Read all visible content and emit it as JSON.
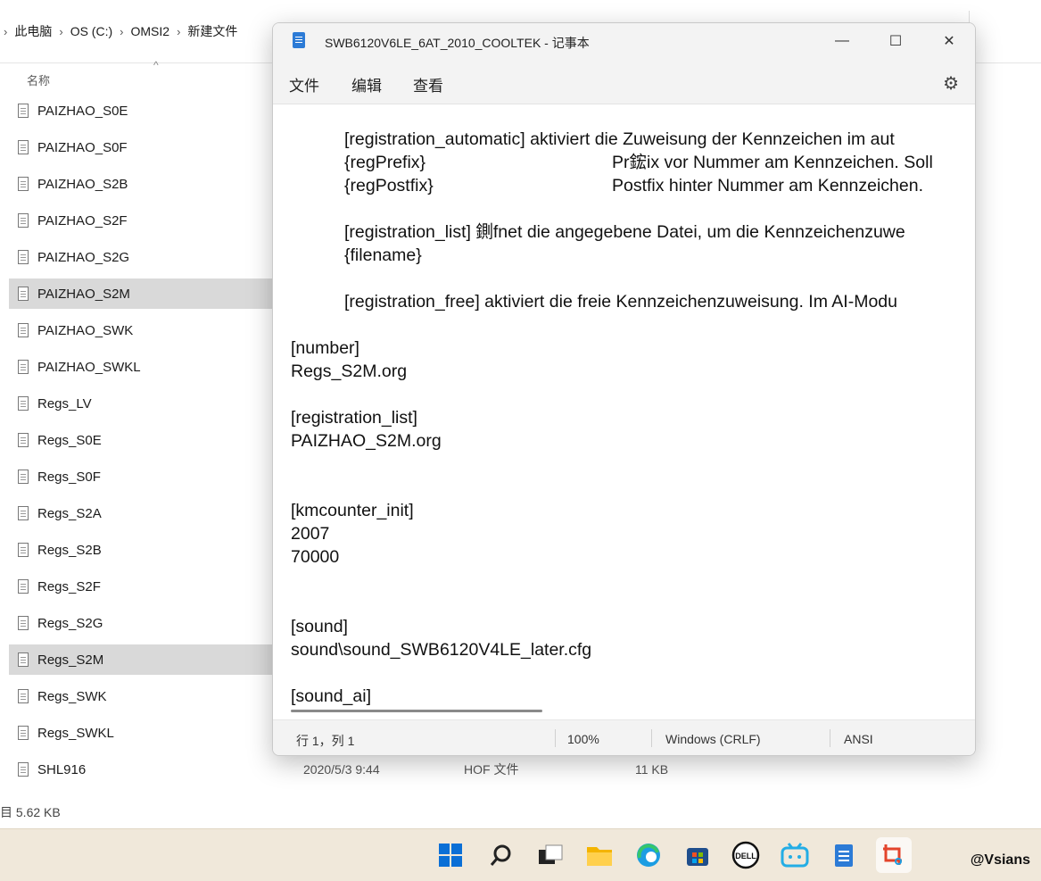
{
  "explorer": {
    "breadcrumb": [
      "此电脑",
      "OS (C:)",
      "OMSI2",
      "新建文件"
    ],
    "column_name": "名称",
    "files": [
      {
        "name": "PAIZHAO_S0E",
        "selected": false
      },
      {
        "name": "PAIZHAO_S0F",
        "selected": false
      },
      {
        "name": "PAIZHAO_S2B",
        "selected": false
      },
      {
        "name": "PAIZHAO_S2F",
        "selected": false
      },
      {
        "name": "PAIZHAO_S2G",
        "selected": false
      },
      {
        "name": "PAIZHAO_S2M",
        "selected": true
      },
      {
        "name": "PAIZHAO_SWK",
        "selected": false
      },
      {
        "name": "PAIZHAO_SWKL",
        "selected": false
      },
      {
        "name": "Regs_LV",
        "selected": false
      },
      {
        "name": "Regs_S0E",
        "selected": false
      },
      {
        "name": "Regs_S0F",
        "selected": false
      },
      {
        "name": "Regs_S2A",
        "selected": false
      },
      {
        "name": "Regs_S2B",
        "selected": false
      },
      {
        "name": "Regs_S2F",
        "selected": false
      },
      {
        "name": "Regs_S2G",
        "selected": false
      },
      {
        "name": "Regs_S2M",
        "selected": true
      },
      {
        "name": "Regs_SWK",
        "selected": false
      },
      {
        "name": "Regs_SWKL",
        "selected": false
      },
      {
        "name": "SHL916",
        "selected": false
      }
    ],
    "last_row_meta": {
      "date": "2020/5/3 9:44",
      "type": "HOF 文件",
      "size": "11 KB"
    },
    "status_left": "目  5.62 KB"
  },
  "notepad": {
    "title": "SWB6120V6LE_6AT_2010_COOLTEK - 记事本",
    "menu": [
      "文件",
      "编辑",
      "查看"
    ],
    "lines": [
      "[registration_automatic] aktiviert die Zuweisung der Kennzeichen im aut",
      "{regPrefix}",
      "Pr鋐ix vor Nummer am Kennzeichen. Soll",
      "{regPostfix}",
      "Postfix hinter Nummer am Kennzeichen.",
      "[registration_list] 鍘fnet die angegebene Datei, um die Kennzeichenzuwe",
      "{filename}",
      "[registration_free] aktiviert die freie Kennzeichenzuweisung. Im AI-Modu",
      "[number]",
      "Regs_S2M.org",
      "[registration_list]",
      "PAIZHAO_S2M.org",
      "[kmcounter_init]",
      "2007",
      "70000",
      "[sound]",
      "sound\\sound_SWB6120V4LE_later.cfg",
      "[sound_ai]"
    ],
    "status": {
      "position": "行 1，列 1",
      "zoom": "100%",
      "line_ending": "Windows (CRLF)",
      "encoding": "ANSI"
    }
  },
  "watermark": "@Vsians",
  "colors": {
    "taskbar_bg": "#f0e8da",
    "selection": "#d9d9d9",
    "notepad_chrome": "#f3f3f3"
  }
}
